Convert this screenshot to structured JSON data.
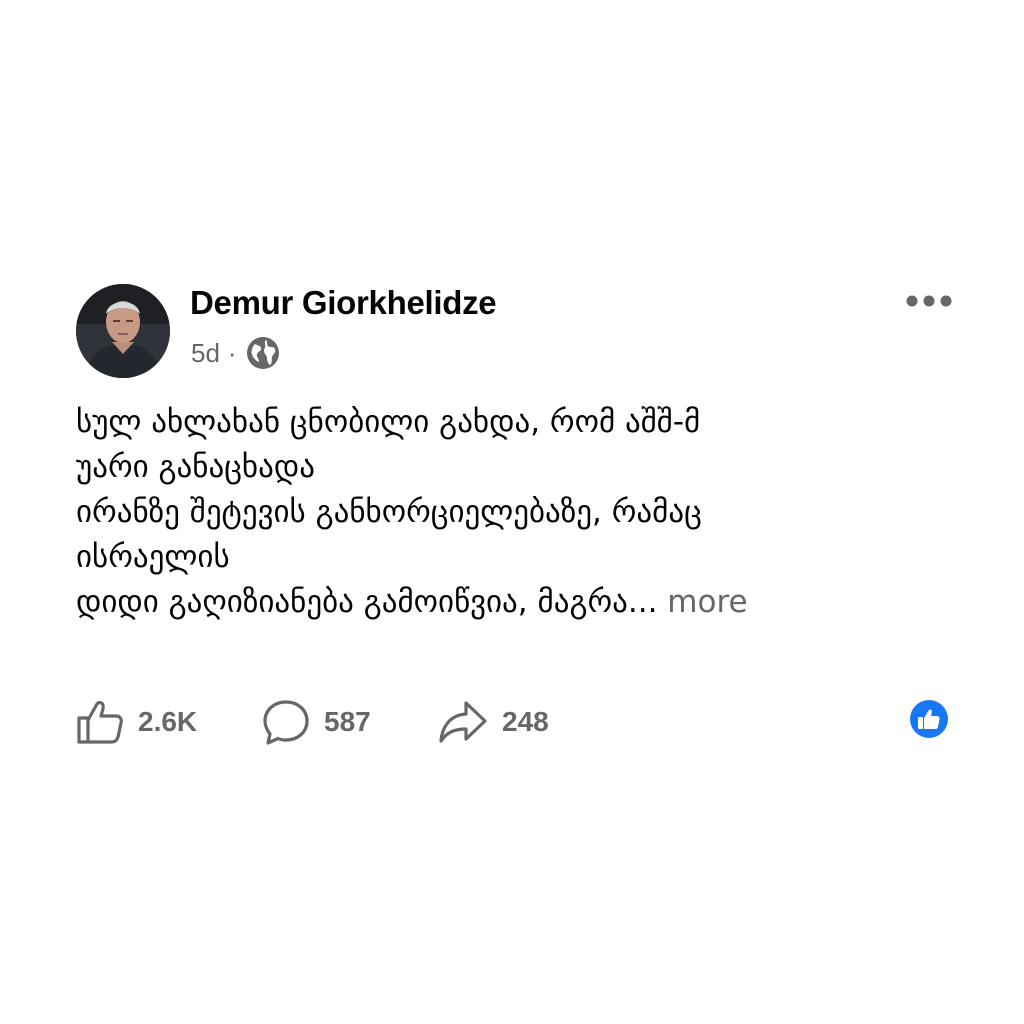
{
  "post": {
    "author": "Demur Giorkhelidze",
    "time": "5d",
    "separator": "·",
    "audience_icon": "globe-icon",
    "menu_icon": "more-options-icon",
    "text_lines": [
      "სულ ახლახან ცნობილი გახდა, რომ აშშ-მ",
      "უარი განაცხადა",
      "ირანზე შეტევის განხორციელებაზე, რამაც",
      "ისრაელის",
      "დიდი გაღიზიანება გამოიწვია, მაგრა..."
    ],
    "see_more": "more",
    "actions": {
      "likes": "2.6K",
      "comments": "587",
      "shares": "248"
    },
    "reaction_icon": "like-reaction-icon",
    "colors": {
      "text": "#050505",
      "secondary": "#65676b",
      "like_blue": "#1877f2",
      "background": "#ffffff"
    }
  }
}
